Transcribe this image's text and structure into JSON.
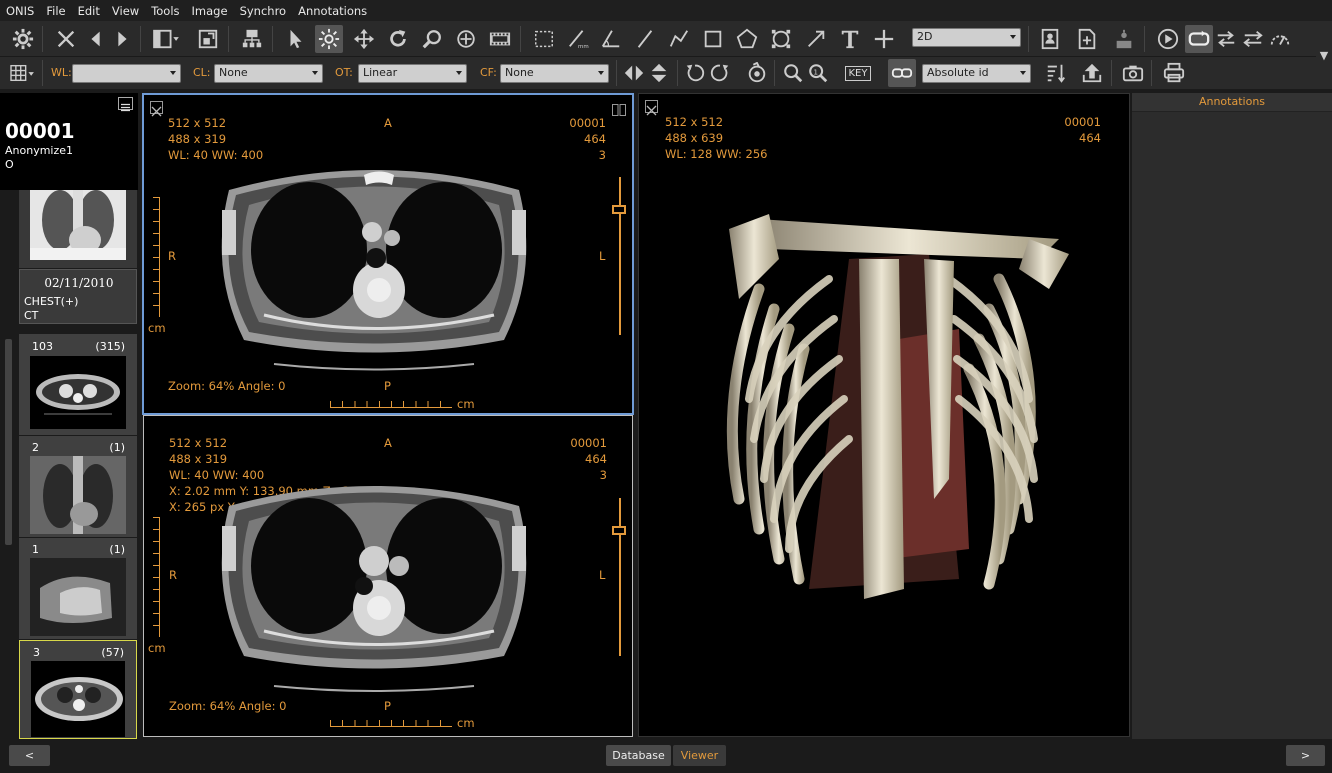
{
  "menu": [
    "ONIS",
    "File",
    "Edit",
    "View",
    "Tools",
    "Image",
    "Synchro",
    "Annotations"
  ],
  "toolbar": {
    "mode_combo": "2D",
    "wl_label": "WL:",
    "wl_value": "",
    "cl_label": "CL:",
    "cl_value": "None",
    "ot_label": "OT:",
    "ot_value": "Linear",
    "cf_label": "CF:",
    "cf_value": "None",
    "key_label": "KEY",
    "id_combo": "Absolute id"
  },
  "patient": {
    "id": "00001",
    "name": "Anonymize1",
    "sex": "O"
  },
  "study": {
    "date": "02/11/2010",
    "description": "CHEST(+)",
    "modality": "CT"
  },
  "series": [
    {
      "number": "103",
      "count": "(315)"
    },
    {
      "number": "2",
      "count": "(1)"
    },
    {
      "number": "1",
      "count": "(1)"
    },
    {
      "number": "3",
      "count": "(57)"
    }
  ],
  "views": [
    {
      "matrix": "512 x 512",
      "display": "488 x 319",
      "wlww": "WL: 40 WW: 400",
      "top": "A",
      "bottom": "P",
      "left": "R",
      "right": "L",
      "id": "00001",
      "slice": "464",
      "series": "3",
      "zoom": "Zoom: 64% Angle: 0",
      "unit": "cm"
    },
    {
      "matrix": "512 x 512",
      "display": "488 x 319",
      "wlww": "WL: 40 WW: 400",
      "top": "A",
      "bottom": "P",
      "left": "R",
      "right": "L",
      "id": "00001",
      "slice": "464",
      "series": "3",
      "coord1": "X: 2.02 mm Y: 133.90 mm Z: -38.00 mm",
      "coord2": "X: 265 px Y: 590 px Value: -938.00",
      "zoom": "Zoom: 64% Angle: 0",
      "unit": "cm"
    },
    {
      "matrix": "512 x 512",
      "display": "488 x 639",
      "wlww": "WL: 128 WW: 256",
      "id": "00001",
      "slice": "464"
    }
  ],
  "annotations_title": "Annotations",
  "bottom": {
    "prev": "<",
    "next": ">",
    "database": "Database",
    "viewer": "Viewer"
  },
  "colors": {
    "overlay": "#e39a3c",
    "selected_view": "#6f9bd6",
    "selected_thumb": "#d8d84a"
  }
}
